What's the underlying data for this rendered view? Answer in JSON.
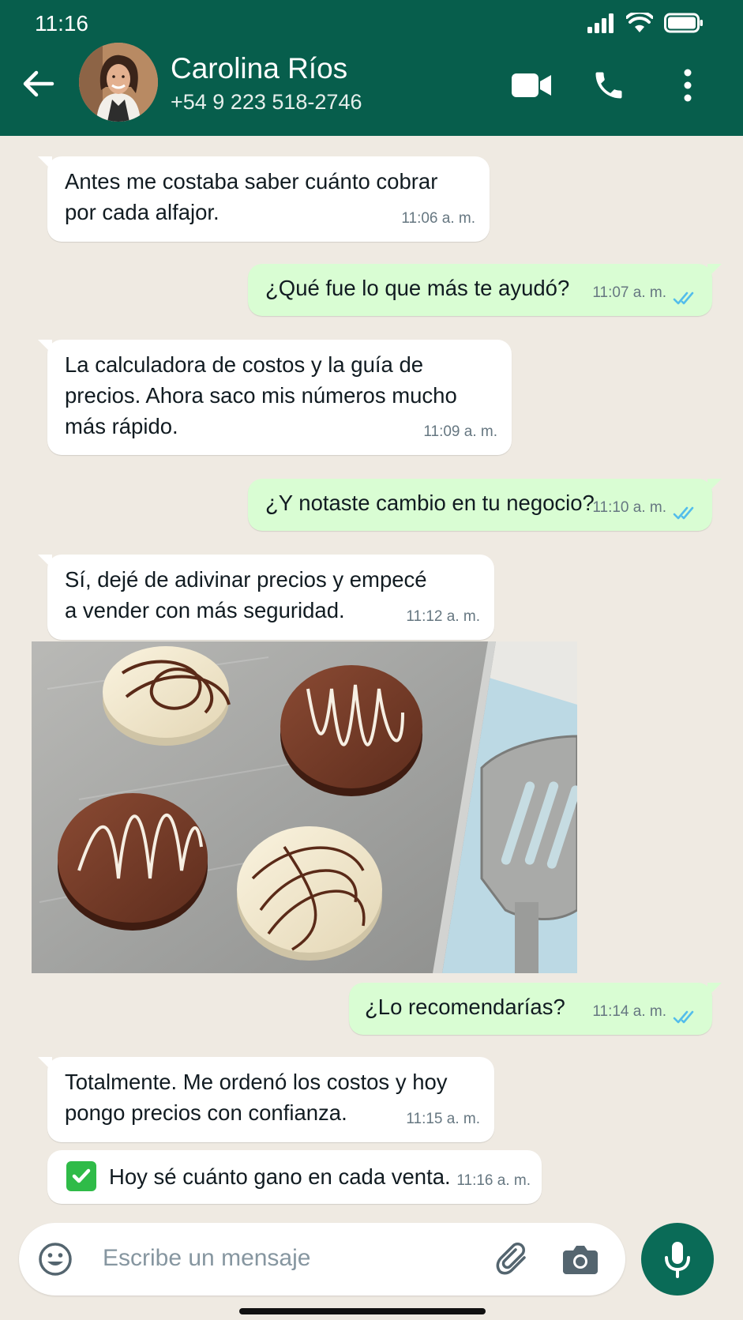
{
  "status_bar": {
    "time": "11:16"
  },
  "header": {
    "contact_name": "Carolina Ríos",
    "contact_phone": "+54 9 223 518-2746"
  },
  "messages": [
    {
      "direction": "in",
      "text_lines": [
        "Antes me costaba saber cuánto cobrar",
        "por cada alfajor."
      ],
      "time": "11:06 a. m."
    },
    {
      "direction": "out",
      "text_lines": [
        "¿Qué fue lo que más te ayudó?"
      ],
      "time": "11:07 a. m.",
      "status": "read"
    },
    {
      "direction": "in",
      "text_lines": [
        "La calculadora de costos y la guía de",
        "precios. Ahora saco mis números mucho",
        "más rápido."
      ],
      "time": "11:09 a. m."
    },
    {
      "direction": "out",
      "text_lines": [
        "¿Y notaste cambio en tu negocio?"
      ],
      "time": "11:10 a. m.",
      "status": "read"
    },
    {
      "direction": "in",
      "text_lines": [
        "Sí, dejé de adivinar precios y empecé",
        "a vender con más seguridad."
      ],
      "time": "11:12 a. m."
    },
    {
      "direction": "out",
      "text_lines": [
        "¿Lo recomendarías?"
      ],
      "time": "11:14 a. m.",
      "status": "read"
    },
    {
      "direction": "in",
      "text_lines": [
        "Totalmente. Me ordenó los costos y hoy",
        "pongo precios con confianza."
      ],
      "time": "11:15 a. m."
    },
    {
      "direction": "in",
      "emoji": "check-mark-button",
      "text_lines": [
        "Hoy sé cuánto gano en cada venta."
      ],
      "time": "11:16 a. m."
    }
  ],
  "composer": {
    "placeholder": "Escribe un mensaje"
  },
  "colors": {
    "header": "#075e4c",
    "chat_bg": "#efeae2",
    "outgoing": "#d9fdd3",
    "incoming": "#ffffff",
    "read_ticks": "#53bdeb",
    "mic_button": "#0a6b57"
  }
}
